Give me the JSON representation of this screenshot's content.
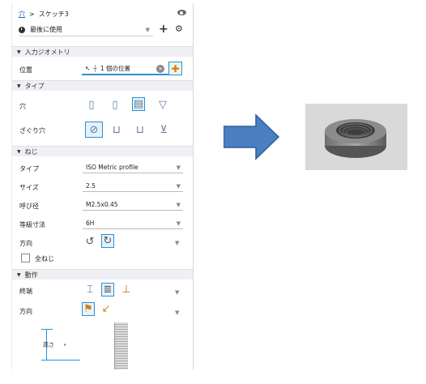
{
  "breadcrumb": {
    "root": "穴",
    "separator": ">",
    "current": "スケッチ3"
  },
  "recent": {
    "label": "最後に使用"
  },
  "sections": {
    "input_geometry": "入力ジオメトリ",
    "type": "タイプ",
    "thread": "ねじ",
    "behavior": "動作"
  },
  "input_geometry": {
    "position_label": "位置",
    "position_value": "1 個の位置"
  },
  "type": {
    "hole_label": "穴",
    "seat_label": "ざぐり穴"
  },
  "thread": {
    "type_label": "タイプ",
    "type_value": "ISO Metric profile",
    "size_label": "サイズ",
    "size_value": "2.5",
    "designation_label": "呼び径",
    "designation_value": "M2.5x0.45",
    "class_label": "等級寸法",
    "class_value": "6H",
    "direction_label": "方向",
    "full_thread_label": "全ねじ"
  },
  "behavior": {
    "termination_label": "終端",
    "direction_label": "方向"
  },
  "preview": {
    "height_label": "高さ"
  },
  "colors": {
    "accent": "#2b8fd6",
    "arrow": "#4a7fc1"
  }
}
